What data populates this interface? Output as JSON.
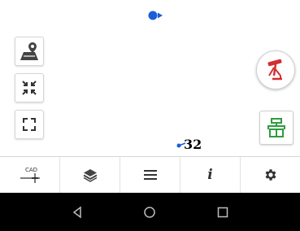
{
  "map": {
    "cursor_number": "32",
    "gps_color": "#1a5ed8"
  },
  "left_tools": [
    {
      "name": "layers-map-button",
      "icon": "map-marker-icon"
    },
    {
      "name": "collapse-button",
      "icon": "collapse-arrows-icon"
    },
    {
      "name": "fullscreen-button",
      "icon": "fullscreen-icon"
    }
  ],
  "right_tools": [
    {
      "name": "stakeout-button",
      "icon": "survey-stake-icon",
      "color": "#d32f2f"
    },
    {
      "name": "record-point-button",
      "icon": "survey-instrument-icon",
      "color": "#2e9c3f"
    }
  ],
  "toolbar": {
    "cad_label": "CAD",
    "info_label": "i",
    "items": [
      "cad-tool",
      "layers",
      "menu",
      "info",
      "settings"
    ]
  },
  "nav": {
    "items": [
      "back",
      "home",
      "recents"
    ]
  }
}
